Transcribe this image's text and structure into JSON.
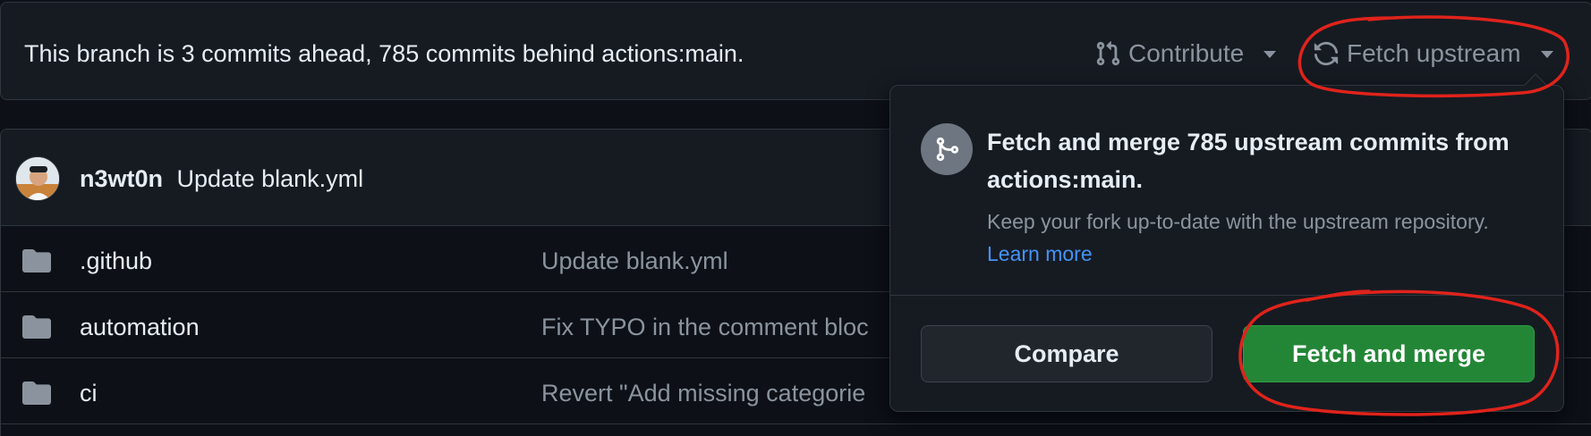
{
  "branch_bar": {
    "status_text": "This branch is 3 commits ahead, 785 commits behind actions:main.",
    "contribute_label": "Contribute",
    "fetch_upstream_label": "Fetch upstream"
  },
  "latest_commit": {
    "author": "n3wt0n",
    "message": "Update blank.yml"
  },
  "files": [
    {
      "name": ".github",
      "message": "Update blank.yml"
    },
    {
      "name": "automation",
      "message": "Fix TYPO in the comment bloc"
    },
    {
      "name": "ci",
      "message": "Revert \"Add missing categorie"
    }
  ],
  "popover": {
    "title": "Fetch and merge 785 upstream commits from actions:main.",
    "description": "Keep your fork up-to-date with the upstream repository.",
    "learn_more_label": "Learn more",
    "compare_label": "Compare",
    "fetch_merge_label": "Fetch and merge"
  },
  "colors": {
    "background": "#0d1117",
    "panel": "#161b22",
    "border": "#30363d",
    "muted_text": "#8b949e",
    "link": "#4493f8",
    "primary_button": "#238636",
    "annotation": "#e0231b"
  }
}
